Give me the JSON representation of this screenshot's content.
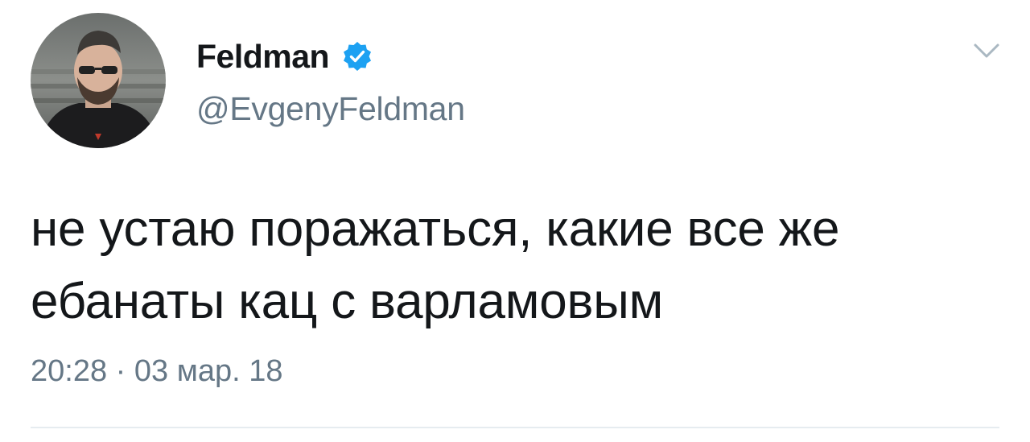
{
  "author": {
    "display_name": "Feldman",
    "handle": "@EvgenyFeldman",
    "verified": true,
    "avatar_icon": "profile-photo"
  },
  "tweet": {
    "text_line_1": "не устаю поражаться, какие все же",
    "text_line_2": "ебанаты кац с варламовым",
    "timestamp": "20:28 · 03 мар. 18"
  },
  "icons": {
    "verified": "verified-badge-icon",
    "menu": "chevron-down-icon"
  },
  "colors": {
    "text_primary": "#14171a",
    "text_secondary": "#657786",
    "verified_blue": "#1da1f2",
    "divider": "#e6ecf0",
    "chevron": "#aab8c2"
  }
}
